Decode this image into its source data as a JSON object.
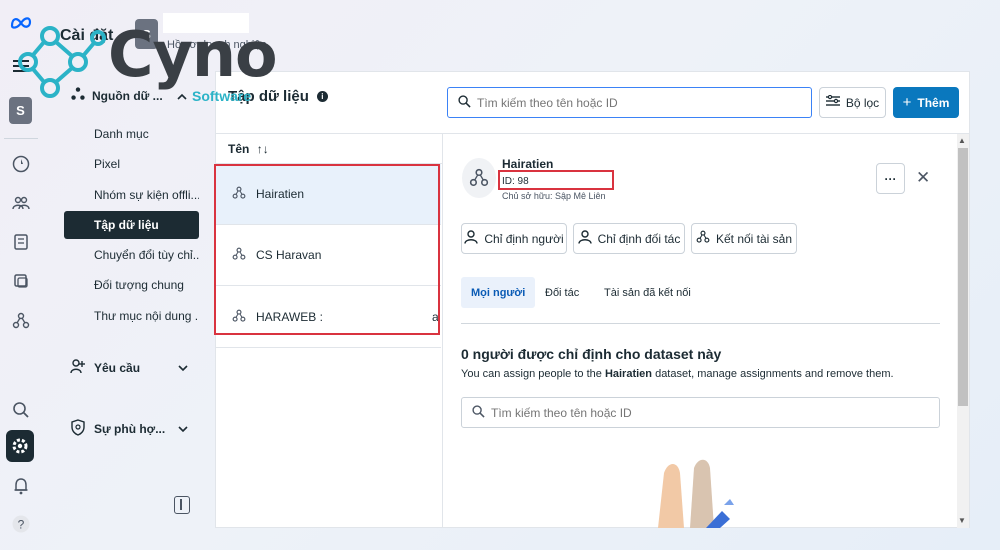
{
  "app": {
    "title": "Cài đặt",
    "business_avatar_letter": "S",
    "business_subtitle": "Hồ sơ doanh nghiệp"
  },
  "watermark": {
    "word": "Cyno",
    "sub": "Software"
  },
  "rail": {
    "avatar_letter": "S",
    "icons": [
      "meta-logo-icon",
      "menu-icon",
      "compass-icon",
      "people-icon",
      "pages-icon",
      "catalog-icon",
      "datasets-icon",
      "search-icon",
      "settings-icon",
      "bell-icon",
      "help-icon"
    ],
    "help_label": "?"
  },
  "nav": {
    "section": "Nguồn dữ ...",
    "items": [
      {
        "label": "Danh mục"
      },
      {
        "label": "Pixel"
      },
      {
        "label": "Nhóm sự kiện offli..."
      },
      {
        "label": "Tập dữ liệu",
        "active": true
      },
      {
        "label": "Chuyển đổi tùy chỉ..."
      },
      {
        "label": "Đối tượng chung"
      },
      {
        "label": "Thư mục nội dung ..."
      }
    ],
    "groups": [
      {
        "label": "Yêu cầu"
      },
      {
        "label": "Sự phù hợ..."
      }
    ]
  },
  "main": {
    "title": "Tập dữ liệu",
    "search_placeholder": "Tìm kiếm theo tên hoặc ID",
    "filter_label": "Bộ lọc",
    "add_label": "Thêm",
    "column_header": "Tên",
    "sort_glyph": "↑↓",
    "rows": [
      {
        "name": "Hairatien",
        "selected": true
      },
      {
        "name": "CS Haravan"
      },
      {
        "name": "HARAWEB :",
        "trailing": "a"
      }
    ]
  },
  "detail": {
    "name": "Hairatien",
    "id_text": "ID: 98",
    "owner_text": "Chủ sở hữu: Sập Mê Liên",
    "more_label": "···",
    "close_label": "✕",
    "actions": [
      "Chỉ định người",
      "Chỉ định đối tác",
      "Kết nối tài sản"
    ],
    "tabs": [
      {
        "label": "Mọi người",
        "active": true
      },
      {
        "label": "Đối tác"
      },
      {
        "label": "Tài sản đã kết nối"
      }
    ],
    "assign_title": "0 người được chỉ định cho dataset này",
    "assign_desc_pre": "You can assign people to the ",
    "assign_desc_name": "Hairatien",
    "assign_desc_post": " dataset, manage assignments and remove them.",
    "search_placeholder": "Tìm kiếm theo tên hoặc ID"
  },
  "colors": {
    "primary": "#0a78be",
    "highlight_box": "#d9333f",
    "selected_row": "#e8f1fb",
    "nav_active": "#1c2b33"
  }
}
